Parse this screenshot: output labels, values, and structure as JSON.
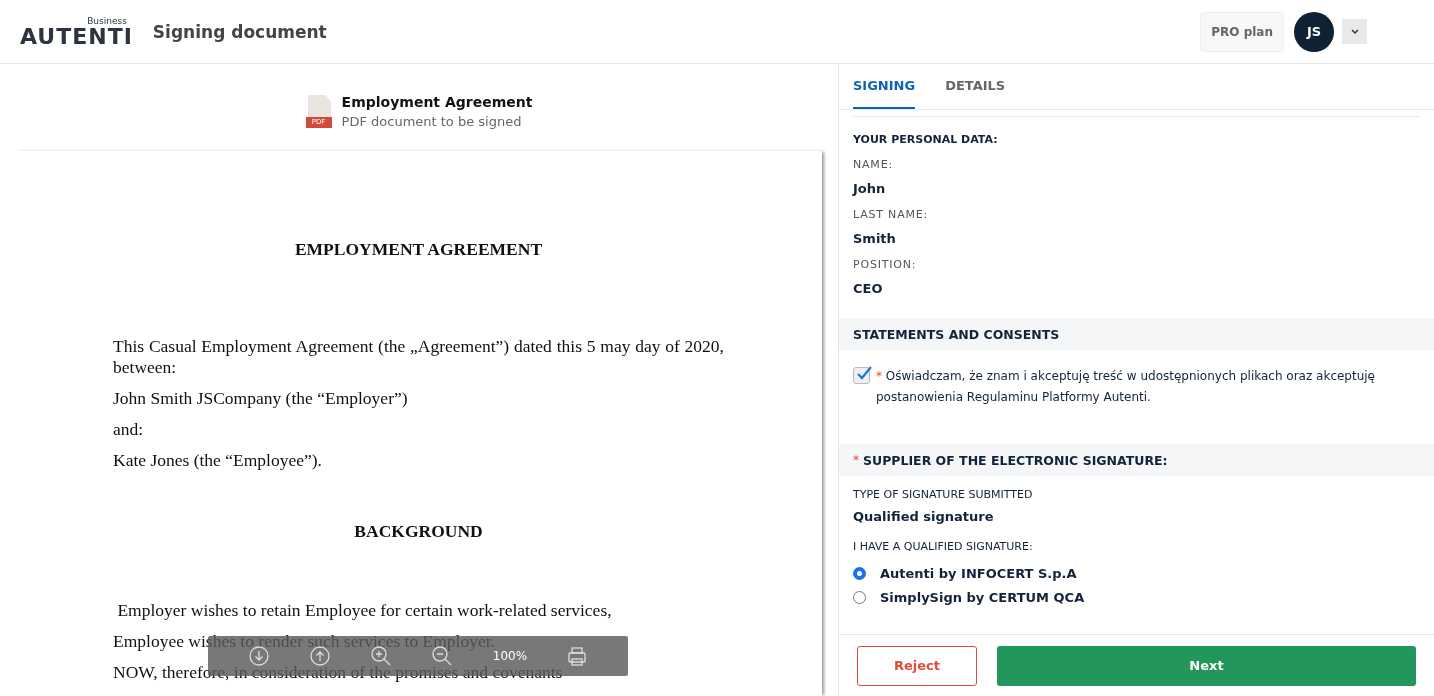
{
  "header": {
    "logo": "AUTENTI",
    "logo_tag": "Business",
    "title": "Signing document",
    "plan": "PRO plan",
    "avatar": "JS"
  },
  "document": {
    "name": "Employment Agreement",
    "subtitle": "PDF document to be signed",
    "file_badge": "PDF",
    "page": [
      {
        "kind": "heading",
        "text": "EMPLOYMENT AGREEMENT"
      },
      {
        "kind": "para",
        "text": "This Casual Employment Agreement (the „Agreement”) dated this 5 may day of 2020, between:"
      },
      {
        "kind": "para",
        "text": "John Smith JSCompany (the “Employer”)"
      },
      {
        "kind": "para",
        "text": "and:"
      },
      {
        "kind": "para",
        "text": "Kate Jones (the “Employee”)."
      },
      {
        "kind": "heading",
        "text": "BACKGROUND"
      },
      {
        "kind": "para",
        "text": " Employer wishes to retain Employee for certain work-related services,"
      },
      {
        "kind": "para",
        "text": "Employee wishes to render such services to Employer."
      },
      {
        "kind": "para",
        "text": "NOW, therefore, in consideration of the promises and covenants"
      }
    ],
    "toolbar": {
      "zoom": "100%"
    }
  },
  "panel": {
    "tabs": [
      {
        "label": "SIGNING",
        "selected": true
      },
      {
        "label": "DETAILS",
        "selected": false
      }
    ],
    "personal_title": "YOUR PERSONAL DATA:",
    "fields": [
      {
        "label": "NAME:",
        "value": "John"
      },
      {
        "label": "LAST NAME:",
        "value": "Smith"
      },
      {
        "label": "POSITION:",
        "value": "CEO"
      }
    ],
    "consents_title": "STATEMENTS AND CONSENTS",
    "consent": {
      "checked": true,
      "required_mark": "*",
      "text": "Oświadczam, że znam i akceptuję treść w udostępnionych plikach oraz akceptuję postanowienia Regulaminu Platformy Autenti."
    },
    "supplier_title": "SUPPLIER OF THE ELECTRONIC SIGNATURE:",
    "supplier_required_mark": "*",
    "type_label": "TYPE OF SIGNATURE SUBMITTED",
    "type_value": "Qualified signature",
    "options_label": "I HAVE A QUALIFIED SIGNATURE:",
    "options": [
      {
        "label": "Autenti by INFOCERT S.p.A",
        "selected": true
      },
      {
        "label": "SimplySign by CERTUM QCA",
        "selected": false
      }
    ],
    "buttons": {
      "reject": "Reject",
      "next": "Next"
    }
  }
}
